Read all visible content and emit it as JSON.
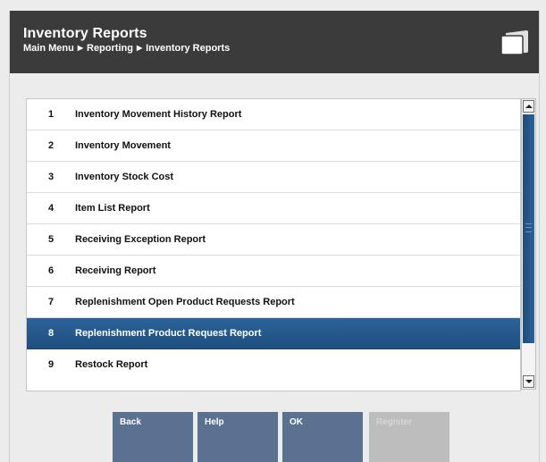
{
  "header": {
    "title": "Inventory Reports",
    "breadcrumb": [
      "Main Menu",
      "Reporting",
      "Inventory Reports"
    ],
    "breadcrumb_separator": "▶"
  },
  "menu": {
    "items": [
      {
        "num": "1",
        "label": "Inventory Movement History Report"
      },
      {
        "num": "2",
        "label": "Inventory Movement"
      },
      {
        "num": "3",
        "label": "Inventory Stock Cost"
      },
      {
        "num": "4",
        "label": "Item List Report"
      },
      {
        "num": "5",
        "label": "Receiving Exception Report"
      },
      {
        "num": "6",
        "label": "Receiving Report"
      },
      {
        "num": "7",
        "label": "Replenishment Open Product Requests Report"
      },
      {
        "num": "8",
        "label": "Replenishment Product Request Report"
      },
      {
        "num": "9",
        "label": "Restock Report"
      }
    ],
    "selected_index": 7
  },
  "buttons": {
    "back": "Back",
    "help": "Help",
    "ok": "OK",
    "register": "Register"
  },
  "colors": {
    "header_bg": "#3b3b3b",
    "selected_row": "#2d6399",
    "button_bg": "#5a7191",
    "button_disabled": "#bdbdbd"
  },
  "icons": {
    "header": "windows-icon",
    "scroll_up": "arrow-up-icon",
    "scroll_down": "arrow-down-icon"
  }
}
